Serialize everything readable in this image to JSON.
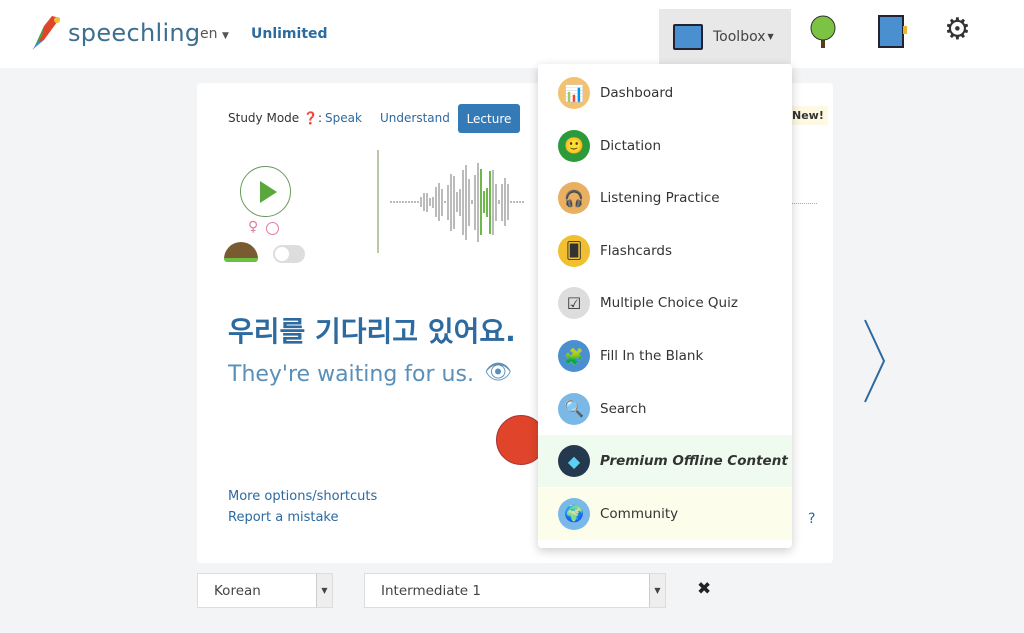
{
  "header": {
    "brand": "speechling",
    "language": "en",
    "plan": "Unlimited",
    "toolbox_label": "Toolbox"
  },
  "study": {
    "label": "Study Mode",
    "modes": [
      "Speak",
      "Understand",
      "Lecture"
    ],
    "active_mode": "Lecture",
    "new_badge": "New!"
  },
  "sentence": {
    "korean": "우리를 기다리고 있어요.",
    "english": "They're waiting for us."
  },
  "links": {
    "more": "More options/shortcuts",
    "report": "Report a mistake",
    "help": "?"
  },
  "menu": {
    "items": [
      {
        "label": "Dashboard",
        "icon": "dashboard-icon"
      },
      {
        "label": "Dictation",
        "icon": "dictation-icon"
      },
      {
        "label": "Listening Practice",
        "icon": "headphones-icon"
      },
      {
        "label": "Flashcards",
        "icon": "flashcards-icon"
      },
      {
        "label": "Multiple Choice Quiz",
        "icon": "quiz-icon"
      },
      {
        "label": "Fill In the Blank",
        "icon": "puzzle-icon"
      },
      {
        "label": "Search",
        "icon": "search-icon"
      },
      {
        "label": "Premium Offline Content",
        "icon": "diamond-icon"
      },
      {
        "label": "Community",
        "icon": "globe-icon"
      }
    ]
  },
  "selectors": {
    "language": "Korean",
    "level": "Intermediate 1"
  },
  "colors": {
    "accent": "#337ab7",
    "record": "#e0442b",
    "play": "#5aa83b"
  }
}
